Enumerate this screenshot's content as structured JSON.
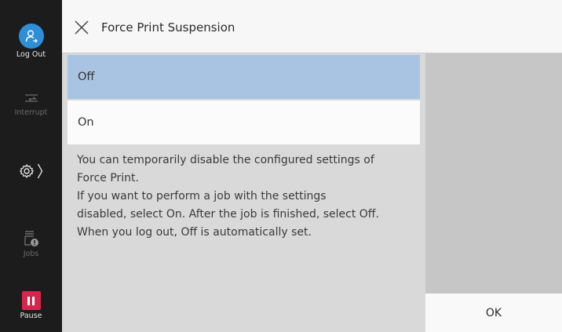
{
  "sidebar": {
    "logout_label": "Log Out",
    "interrupt_label": "Interrupt",
    "jobs_label": "Jobs",
    "pause_label": "Pause"
  },
  "header": {
    "title": "Force Print Suspension"
  },
  "options": [
    {
      "label": "Off",
      "selected": true
    },
    {
      "label": "On",
      "selected": false
    }
  ],
  "description": [
    "You can temporarily disable the configured settings of",
    "Force Print.",
    "If you want to perform a job with the settings",
    "disabled, select On. After the job is finished, select Off.",
    "When you log out, Off is automatically set."
  ],
  "actions": {
    "ok_label": "OK"
  },
  "colors": {
    "sidebar_bg": "#1c1c1c",
    "selected_option": "#a9c3e3",
    "logout_accent": "#2e8fd6",
    "pause_accent": "#d7264e"
  }
}
